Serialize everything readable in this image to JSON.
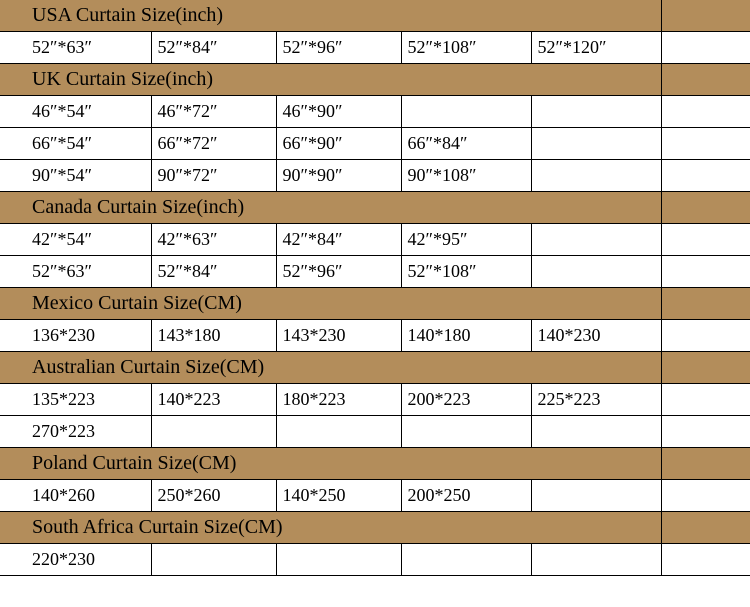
{
  "chart_data": {
    "type": "table",
    "sections": [
      {
        "header": "USA Curtain Size(inch)",
        "rows": [
          [
            "52″*63″",
            "52″*84″",
            "52″*96″",
            "52″*108″",
            "52″*120″"
          ]
        ]
      },
      {
        "header": "UK Curtain Size(inch)",
        "rows": [
          [
            "46″*54″",
            "46″*72″",
            "46″*90″",
            "",
            ""
          ],
          [
            "66″*54″",
            "66″*72″",
            "66″*90″",
            "66″*84″",
            ""
          ],
          [
            "90″*54″",
            "90″*72″",
            "90″*90″",
            "90″*108″",
            ""
          ]
        ]
      },
      {
        "header": "Canada Curtain Size(inch)",
        "rows": [
          [
            "42″*54″",
            "42″*63″",
            "42″*84″",
            "42″*95″",
            ""
          ],
          [
            "52″*63″",
            "52″*84″",
            "52″*96″",
            "52″*108″",
            ""
          ]
        ]
      },
      {
        "header": "Mexico Curtain Size(CM)",
        "rows": [
          [
            "136*230",
            "143*180",
            "143*230",
            "140*180",
            "140*230"
          ]
        ]
      },
      {
        "header": "Australian Curtain Size(CM)",
        "rows": [
          [
            "135*223",
            "140*223",
            "180*223",
            "200*223",
            "225*223"
          ],
          [
            "270*223",
            "",
            "",
            "",
            ""
          ]
        ]
      },
      {
        "header": "Poland Curtain Size(CM)",
        "rows": [
          [
            "140*260",
            "250*260",
            "140*250",
            "200*250",
            ""
          ]
        ]
      },
      {
        "header": "South Africa Curtain Size(CM)",
        "rows": [
          [
            "220*230",
            "",
            "",
            "",
            ""
          ]
        ]
      }
    ]
  }
}
